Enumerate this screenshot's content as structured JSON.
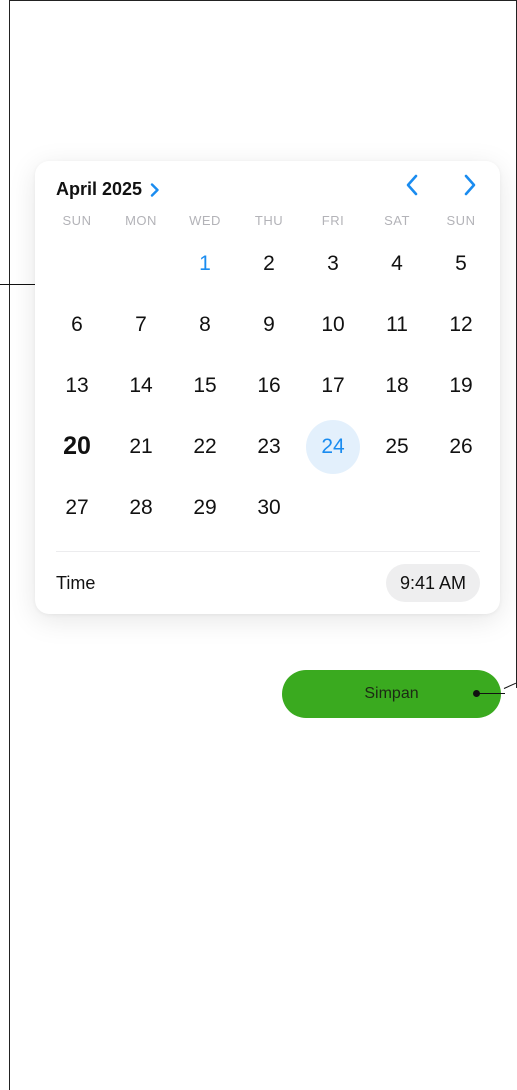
{
  "calendar": {
    "month_label": "April 2025",
    "weekdays": [
      "SUN",
      "MON",
      "WED",
      "THU",
      "FRI",
      "SAT",
      "SUN"
    ],
    "weeks": [
      [
        "",
        "",
        "1",
        "2",
        "3",
        "4",
        "5"
      ],
      [
        "6",
        "7",
        "8",
        "9",
        "10",
        "11",
        "12"
      ],
      [
        "13",
        "14",
        "15",
        "16",
        "17",
        "18",
        "19"
      ],
      [
        "20",
        "21",
        "22",
        "23",
        "24",
        "25",
        "26"
      ],
      [
        "27",
        "28",
        "29",
        "30",
        "",
        "",
        ""
      ]
    ],
    "first_day_highlight": "1",
    "today": "20",
    "selected": "24",
    "accent_color": "#1a8cf0",
    "selected_bg_color": "#e3f0fc",
    "icons": {
      "month_expand": "chevron-right-icon",
      "prev_month": "chevron-left-icon",
      "next_month": "chevron-right-icon"
    }
  },
  "time": {
    "label": "Time",
    "value": "9:41 AM"
  },
  "save_button": {
    "label": "Simpan",
    "color": "#3aaa1f"
  }
}
